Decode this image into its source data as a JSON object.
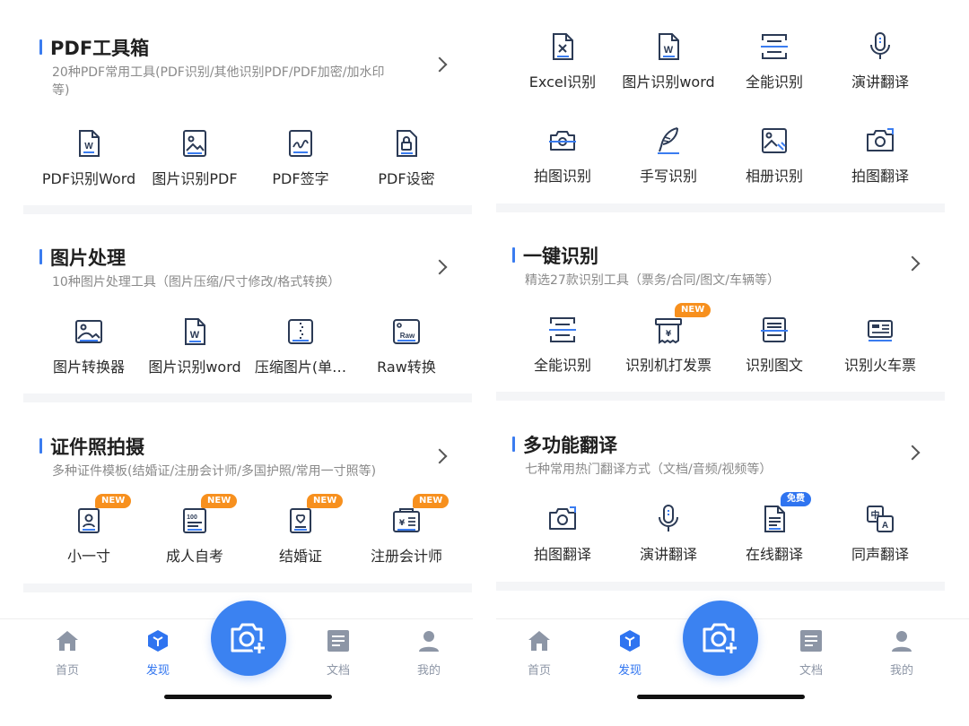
{
  "colors": {
    "accent": "#3a7cf0",
    "new_badge": "#f7901e",
    "free_badge": "#2f74f0",
    "tab_inactive": "#8d96a6"
  },
  "left": {
    "sections": [
      {
        "title": "PDF工具箱",
        "subtitle": "20种PDF常用工具(PDF识别/其他识别PDF/PDF加密/加水印等)",
        "tools": [
          {
            "label": "PDF识别Word",
            "icon": "word-doc-icon"
          },
          {
            "label": "图片识别PDF",
            "icon": "image-icon"
          },
          {
            "label": "PDF签字",
            "icon": "signature-icon"
          },
          {
            "label": "PDF设密",
            "icon": "lock-doc-icon"
          }
        ]
      },
      {
        "title": "图片处理",
        "subtitle": "10种图片处理工具（图片压缩/尺寸修改/格式转换）",
        "tools": [
          {
            "label": "图片转换器",
            "icon": "image-icon"
          },
          {
            "label": "图片识别word",
            "icon": "word-doc-icon"
          },
          {
            "label": "压缩图片(单…",
            "icon": "zip-icon"
          },
          {
            "label": "Raw转换",
            "icon": "raw-icon"
          }
        ]
      },
      {
        "title": "证件照拍摄",
        "subtitle": "多种证件模板(结婚证/注册会计师/多国护照/常用一寸照等)",
        "tools": [
          {
            "label": "小一寸",
            "icon": "id-photo-icon",
            "badge": "NEW"
          },
          {
            "label": "成人自考",
            "icon": "exam-icon",
            "badge": "NEW"
          },
          {
            "label": "结婚证",
            "icon": "marriage-icon",
            "badge": "NEW"
          },
          {
            "label": "注册会计师",
            "icon": "accountant-icon",
            "badge": "NEW"
          }
        ]
      }
    ]
  },
  "right": {
    "top_tools": [
      {
        "label": "Excel识别",
        "icon": "excel-doc-icon"
      },
      {
        "label": "图片识别word",
        "icon": "word-doc-icon"
      },
      {
        "label": "全能识别",
        "icon": "scan-icon"
      },
      {
        "label": "演讲翻译",
        "icon": "microphone-icon"
      }
    ],
    "top_tools_2": [
      {
        "label": "拍图识别",
        "icon": "camera-scan-icon"
      },
      {
        "label": "手写识别",
        "icon": "quill-icon"
      },
      {
        "label": "相册识别",
        "icon": "album-icon"
      },
      {
        "label": "拍图翻译",
        "icon": "camera-translate-icon"
      }
    ],
    "sections": [
      {
        "title": "一键识别",
        "subtitle": "精选27款识别工具（票务/合同/图文/车辆等）",
        "tools": [
          {
            "label": "全能识别",
            "icon": "scan-icon"
          },
          {
            "label": "识别机打发票",
            "icon": "invoice-icon",
            "badge": "NEW"
          },
          {
            "label": "识别图文",
            "icon": "text-scan-icon"
          },
          {
            "label": "识别火车票",
            "icon": "train-ticket-icon"
          }
        ]
      },
      {
        "title": "多功能翻译",
        "subtitle": "七种常用热门翻译方式（文档/音频/视频等）",
        "tools": [
          {
            "label": "拍图翻译",
            "icon": "camera-translate-icon"
          },
          {
            "label": "演讲翻译",
            "icon": "microphone-icon"
          },
          {
            "label": "在线翻译",
            "icon": "document-icon",
            "badge": "免费"
          },
          {
            "label": "同声翻译",
            "icon": "language-icon"
          }
        ]
      }
    ]
  },
  "tabbar": {
    "tabs": [
      {
        "label": "首页",
        "icon": "home-icon"
      },
      {
        "label": "发现",
        "icon": "cube-icon",
        "active": true
      },
      {
        "label": "文档",
        "icon": "document-tab-icon"
      },
      {
        "label": "我的",
        "icon": "profile-icon"
      }
    ],
    "camera_icon": "camera-plus-icon"
  }
}
